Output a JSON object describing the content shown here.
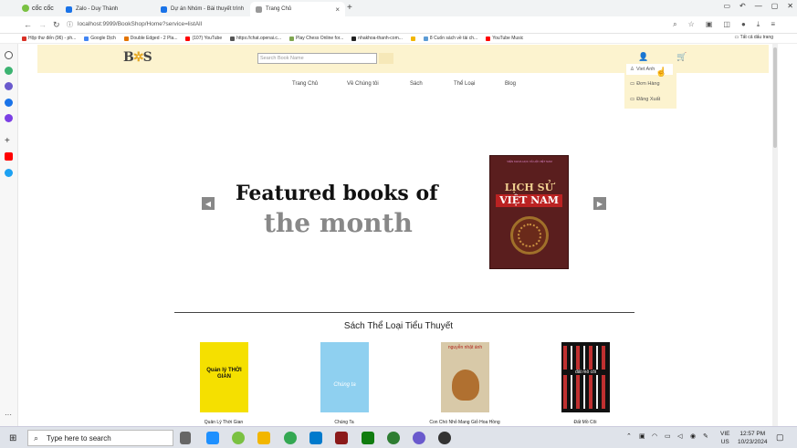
{
  "browser": {
    "brand": "cốc cốc",
    "tabs": [
      {
        "label": "Zalo - Duy Thành",
        "color": "#1a73e8"
      },
      {
        "label": "Dự án Nhóm - Bài thuyết trình",
        "color": "#1a73e8"
      },
      {
        "label": "Trang Chủ",
        "color": "#888888"
      }
    ],
    "new_tab": "+",
    "url": "localhost:9999/BookShop/Home?service=listAll",
    "bookmarks": [
      {
        "label": "Hộp thư đến (96) - ph...",
        "color": "#d93025"
      },
      {
        "label": "Google Dịch",
        "color": "#4285f4"
      },
      {
        "label": "Double Edged - 2 Pla...",
        "color": "#e37400"
      },
      {
        "label": "(107) YouTube",
        "color": "#ff0000"
      },
      {
        "label": "https://chat.openai.c...",
        "color": "#555555"
      },
      {
        "label": "Play Chess Online for...",
        "color": "#7fa650"
      },
      {
        "label": "nhakhoa-thanh-com...",
        "color": "#222222"
      },
      {
        "label": "",
        "color": "#f2b600"
      },
      {
        "label": "8 Cuốn sách về tài ch...",
        "color": "#5b9bd5"
      },
      {
        "label": "YouTube Music",
        "color": "#ff0000"
      }
    ],
    "all_bookmarks": "Tất cả dấu trang"
  },
  "site": {
    "logo_b": "B",
    "logo_star": "✲",
    "logo_s": "S",
    "search_placeholder": "Search Book Name",
    "user_menu": [
      {
        "label": "Viet Anh",
        "icon": "user-icon"
      },
      {
        "label": "Đơn Hàng",
        "icon": "cart-icon"
      },
      {
        "label": "Đăng Xuất",
        "icon": "logout-icon"
      }
    ],
    "nav": [
      "Trang Chủ",
      "Về Chúng tôi",
      "Sách",
      "Thể Loại",
      "Blog"
    ],
    "hero": {
      "line1": "Featured books of",
      "line2": "the month",
      "book_publisher": "VIỆN KHOA HỌC XÃ HỘI VIỆT NAM",
      "book_title_1": "LỊCH SỬ",
      "book_title_2": "VIỆT NAM"
    },
    "section_title": "Sách Thể Loại Tiểu Thuyết",
    "books": [
      {
        "title": "Quản Lý Thời Gian",
        "cover": "#f5e000",
        "accent": "#111111",
        "cover_text": "Quản lý THỜI GIAN"
      },
      {
        "title": "Chúng Ta",
        "cover": "#8fd0f0",
        "accent": "#ffffff",
        "cover_text": "Chúng ta"
      },
      {
        "title": "Con Chó Nhỏ Mang Giỏ Hoa Hồng",
        "cover": "#d8c9a8",
        "accent": "#b0241c",
        "cover_text": "nguyễn nhật ánh"
      },
      {
        "title": "Đất Mồ Côi",
        "cover": "#111111",
        "accent": "#c03030",
        "cover_text": "đất mồ côi"
      }
    ]
  },
  "taskbar": {
    "search_placeholder": "Type here to search",
    "lang": "VIE",
    "region": "US",
    "time": "12:57 PM",
    "date": "10/23/2024"
  }
}
